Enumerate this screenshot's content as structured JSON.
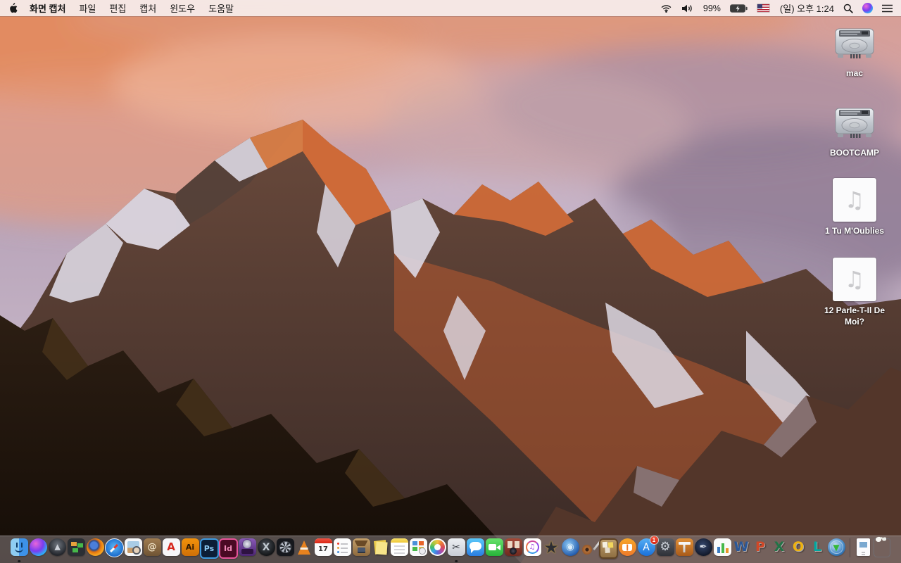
{
  "menu_bar": {
    "apple_logo": "apple-icon",
    "app_name": "화면 캡처",
    "menus": [
      "파일",
      "편집",
      "캡처",
      "윈도우",
      "도움말"
    ],
    "status": {
      "icons": [
        "wifi",
        "volume",
        "battery-charging",
        "us-flag",
        "spotlight",
        "siri",
        "notification-center"
      ],
      "battery_percent": "99%",
      "clock": "(일) 오후 1:24"
    }
  },
  "desktop": {
    "icons": [
      {
        "label": "mac",
        "type": "hard-drive"
      },
      {
        "label": "BOOTCAMP",
        "type": "hard-drive"
      },
      {
        "label": "1 Tu M'Oublies",
        "type": "audio-file"
      },
      {
        "label": "12 Parle-T-Il De Moi?",
        "type": "audio-file"
      }
    ],
    "audio_glyph": "♫"
  },
  "dock": {
    "items": [
      {
        "name": "finder",
        "cls": "finder",
        "bg": "linear-gradient(90deg,#8ecdf2 0 48%,#3d92e8 48%)",
        "running": true
      },
      {
        "name": "siri",
        "shape": "circle",
        "bg": "radial-gradient(circle at 35% 30%,#e766d9,#7a3df0 45%,#2bb3f5 75%,#143a8e)"
      },
      {
        "name": "launchpad",
        "shape": "circle",
        "bg": "radial-gradient(circle at 50% 38%,#70767f,#22252b 72%)",
        "glyph": "▶",
        "fg": "#cfd3da",
        "fs": 11,
        "rot": -90
      },
      {
        "name": "display-tiles-app",
        "cls": "tilesapp",
        "bg": "#2b2f34"
      },
      {
        "name": "firefox",
        "shape": "circle",
        "bg": "radial-gradient(circle at 42% 40%,#4a7edb 0 24%,#2b4a8c 32%,#e8740c 46%,#f5a623 68%,#cf5a00 100%)"
      },
      {
        "name": "safari",
        "cls": "safari",
        "shape": "circle",
        "bg": "radial-gradient(circle at 50% 45%,#5db9f7,#1465c9 78%)"
      },
      {
        "name": "preview",
        "cls": "preview",
        "bg": "#f5f6f8"
      },
      {
        "name": "contacts",
        "bg": "linear-gradient(#a07c50,#6f5434)",
        "glyph": "@",
        "fg": "#ecdfc2",
        "fs": 13,
        "bold": true
      },
      {
        "name": "acrobat-reader",
        "bg": "#f6f6f8",
        "glyph": "A",
        "fg": "#d6281e",
        "fs": 15,
        "bold": true
      },
      {
        "name": "illustrator",
        "bg": "linear-gradient(#f2920a,#cf7008)",
        "glyph": "Ai",
        "fg": "#2e1800",
        "fs": 11,
        "bold": true
      },
      {
        "name": "photoshop",
        "bg": "#0c1e36",
        "border": "2px solid #3f9be0",
        "glyph": "Ps",
        "fg": "#8ec9f2",
        "fs": 11,
        "bold": true
      },
      {
        "name": "indesign",
        "bg": "#4a0a24",
        "border": "2px solid #e8559a",
        "glyph": "Id",
        "fg": "#f08ab8",
        "fs": 11,
        "bold": true
      },
      {
        "name": "toast-titanium",
        "cls": "toast",
        "bg": "linear-gradient(#8a5ab8,#4a2470)"
      },
      {
        "name": "xbmc",
        "shape": "circle",
        "bg": "radial-gradient(circle at 45% 40%,#4a5058,#101214 75%)",
        "glyph": "X",
        "fg": "#c2cbd2",
        "fs": 14,
        "bold": true
      },
      {
        "name": "fan-control",
        "cls": "fandisk",
        "bg": "#16181d"
      },
      {
        "name": "vlc",
        "cls": "vlc",
        "shape": "none"
      },
      {
        "name": "calendar",
        "cls": "cal",
        "bg": "#fcfcfc",
        "glyph": "17",
        "fg": "#333333",
        "fs": 10,
        "bold": true
      },
      {
        "name": "reminders",
        "cls": "rem",
        "bg": "#fcfcfc"
      },
      {
        "name": "archive-utility",
        "cls": "archbox",
        "bg": "linear-gradient(#c4a06a,#8e6a3e)"
      },
      {
        "name": "stickies",
        "cls": "stickies",
        "shape": "none"
      },
      {
        "name": "notes",
        "cls": "notes",
        "bg": "#ffffff"
      },
      {
        "name": "page-layout-app",
        "cls": "pub",
        "bg": "#fafafa"
      },
      {
        "name": "photos",
        "cls": "photos",
        "shape": "circle",
        "bg": "#fdfdfd"
      },
      {
        "name": "grab",
        "bg": "linear-gradient(#eceff3,#c9ced6)",
        "glyph": "✂",
        "fg": "#3a3e45",
        "fs": 14,
        "running": true
      },
      {
        "name": "messages",
        "cls": "msg",
        "bg": "linear-gradient(#5ac8fa,#2a7de1)"
      },
      {
        "name": "facetime",
        "cls": "ft",
        "bg": "linear-gradient(#67e26b,#27b33a)"
      },
      {
        "name": "photo-booth",
        "cls": "pb",
        "bg": "linear-gradient(#a34a38,#6e2a20)"
      },
      {
        "name": "itunes",
        "cls": "itunes",
        "bg": "#ffffff",
        "glyph": "♫",
        "fg": "#a03ae0",
        "fs": 10,
        "bold": true
      },
      {
        "name": "imovie",
        "cls": "imovie",
        "shape": "none",
        "glyph": "★",
        "fg": "#2d2d33",
        "fs": 24
      },
      {
        "name": "dvd-ripper",
        "shape": "circle",
        "bg": "radial-gradient(circle at 40% 35%,#8cc8f5,#1c55a8 78%)",
        "glyph": "◉",
        "fg": "#d8ecfa",
        "fs": 13
      },
      {
        "name": "garageband",
        "cls": "gb",
        "shape": "none"
      },
      {
        "name": "pinboard-app",
        "cls": "corkboard",
        "bg": "linear-gradient(#bb9c6a,#8f6f42)"
      },
      {
        "name": "ibooks",
        "cls": "ibooks",
        "shape": "circle",
        "bg": "linear-gradient(#f7a62a,#ef7a2a)"
      },
      {
        "name": "app-store",
        "shape": "circle",
        "bg": "linear-gradient(#55aef5,#1a70d8)",
        "glyph": "A",
        "fg": "#ffffff",
        "fs": 14,
        "badge": "1"
      },
      {
        "name": "system-preferences",
        "bg": "linear-gradient(#5a5e66,#2e3138)",
        "glyph": "⚙",
        "fg": "#cdd2da",
        "fs": 17
      },
      {
        "name": "keynote",
        "cls": "keynote",
        "bg": "linear-gradient(#e09038,#a85a1a)"
      },
      {
        "name": "pages",
        "shape": "circle",
        "bg": "radial-gradient(circle at 45% 40%,#35486e,#0e1322 80%)",
        "glyph": "✒",
        "fg": "#dde2ea",
        "fs": 13
      },
      {
        "name": "numbers",
        "bg": "linear-gradient(#3a7ac0,#3a7ac0) 5px calc(100% - 4px)/4px 9px no-repeat,linear-gradient(#46b84a,#46b84a) 11px calc(100% - 4px)/4px 14px no-repeat,linear-gradient(#e8952a,#e8952a) 17px calc(100% - 4px)/4px 7px no-repeat,#fafafa"
      },
      {
        "name": "word",
        "cls": "o3d",
        "shape": "none",
        "glyph": "W",
        "fg": "#2b5797",
        "fs": 19,
        "bold": true
      },
      {
        "name": "powerpoint",
        "cls": "o3d",
        "shape": "none",
        "glyph": "P",
        "fg": "#d24726",
        "fs": 19,
        "bold": true
      },
      {
        "name": "excel",
        "cls": "o3d",
        "shape": "none",
        "glyph": "X",
        "fg": "#217346",
        "fs": 19,
        "bold": true
      },
      {
        "name": "outlook",
        "cls": "o3d",
        "shape": "none",
        "glyph": "O",
        "fg": "#eeb211",
        "fs": 19,
        "bold": true
      },
      {
        "name": "lync",
        "cls": "o3d",
        "shape": "none",
        "glyph": "L",
        "fg": "#00a8a0",
        "fs": 19,
        "bold": true
      },
      {
        "name": "download-manager",
        "cls": "globe",
        "shape": "circle",
        "bg": "radial-gradient(circle at 42% 38%,#cfe4f5,#4a8cc8 55%,#1c5a9a 85%)",
        "glyph": "▼",
        "fg": "#35b83a",
        "fs": 12,
        "bold": true
      },
      {
        "divider": true
      },
      {
        "name": "document-file",
        "cls": "docfile",
        "shape": "none"
      },
      {
        "name": "trash-full",
        "cls": "trash",
        "shape": "none"
      }
    ]
  }
}
